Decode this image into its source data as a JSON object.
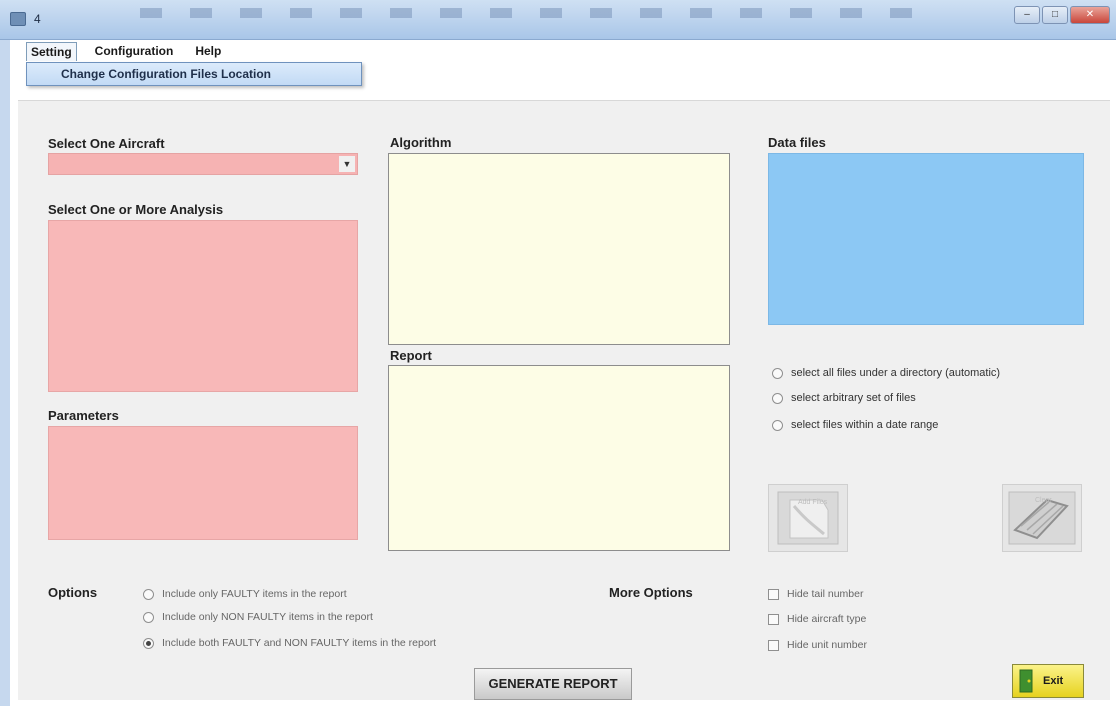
{
  "window": {
    "title": "4",
    "controls": [
      "–",
      "□",
      "✕"
    ]
  },
  "menu": {
    "items": [
      "Setting",
      "Configuration",
      "Help"
    ],
    "dropdown_item": "Change Configuration Files Location"
  },
  "aircraft": {
    "label": "Select One Aircraft",
    "value": ""
  },
  "analysis": {
    "label": "Select One or More Analysis"
  },
  "parameters": {
    "label": "Parameters"
  },
  "algorithm": {
    "label": "Algorithm"
  },
  "report": {
    "label": "Report"
  },
  "datafiles": {
    "label": "Data files",
    "selection_modes": [
      "select all files under a directory (automatic)",
      "select arbitrary set of files",
      "select files within a date range"
    ]
  },
  "buttons": {
    "add_files": "Add Files",
    "clear": "Clear",
    "generate": "GENERATE REPORT",
    "exit": "Exit"
  },
  "options": {
    "label": "Options",
    "items": [
      {
        "text": "Include only FAULTY items in the report",
        "checked": false
      },
      {
        "text": "Include only NON FAULTY items in the report",
        "checked": false
      },
      {
        "text": "Include both FAULTY and NON FAULTY items in the report",
        "checked": true
      }
    ]
  },
  "more_options": {
    "label": "More Options",
    "items": [
      "Hide tail number",
      "Hide aircraft type",
      "Hide unit number"
    ]
  },
  "colors": {
    "pink": "#f8b8b8",
    "yellow": "#fdfde6",
    "blue": "#8cc8f4"
  }
}
